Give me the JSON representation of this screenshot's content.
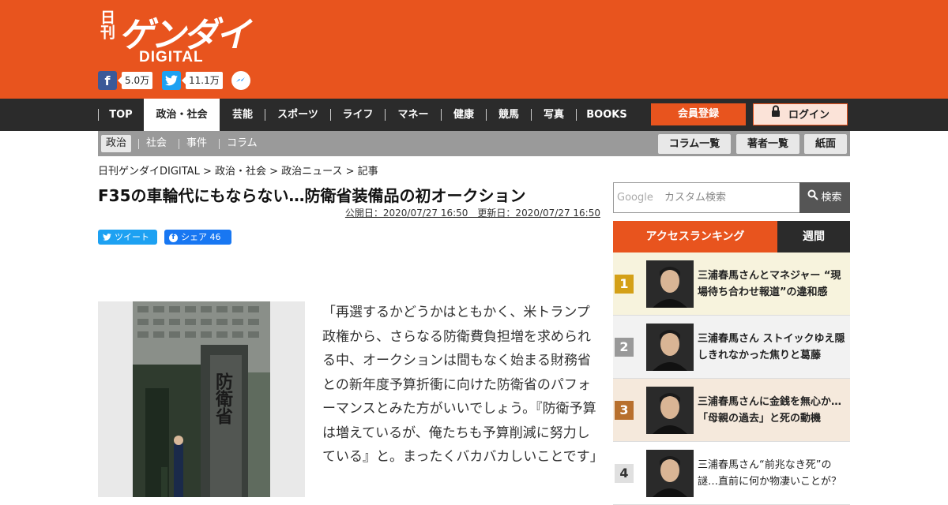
{
  "header": {
    "logo_small": "日刊",
    "logo_main": "ゲンダイ",
    "logo_sub": "DIGITAL",
    "facebook_count": "5.0万",
    "twitter_count": "11.1万"
  },
  "nav": {
    "items": [
      {
        "label": "TOP"
      },
      {
        "label": "政治・社会"
      },
      {
        "label": "芸能"
      },
      {
        "label": "スポーツ"
      },
      {
        "label": "ライフ"
      },
      {
        "label": "マネー"
      },
      {
        "label": "健康"
      },
      {
        "label": "競馬"
      },
      {
        "label": "写真"
      },
      {
        "label": "BOOKS"
      }
    ],
    "register_label": "会員登録",
    "login_label": "ログイン"
  },
  "subnav": {
    "items": [
      {
        "label": "政治"
      },
      {
        "label": "社会"
      },
      {
        "label": "事件"
      },
      {
        "label": "コラム"
      }
    ],
    "buttons": [
      {
        "label": "コラム一覧"
      },
      {
        "label": "著者一覧"
      },
      {
        "label": "紙面"
      }
    ]
  },
  "breadcrumb": "日刊ゲンダイDIGITAL > 政治・社会 > 政治ニュース > 記事",
  "article": {
    "title": "F35の車輪代にもならない…防衛省装備品の初オークション",
    "dates": "公開日：2020/07/27 16:50　更新日：2020/07/27 16:50",
    "tweet_label": "ツイート",
    "share_label": "シェア 46",
    "body": "「再選するかどうかはともかく、米トランプ政権から、さらなる防衛費負担増を求められる中、オークションは間もなく始まる財務省との新年度予算折衝に向けた防衛省のパフォーマンスとみた方がいいでしょう。『防衛予算は増えているが、俺たちも予算削減に努力している』と。まったくバカバカしいことです」",
    "photo_sign_text": "防衛省"
  },
  "search": {
    "placeholder_brand": "Google",
    "placeholder": "カスタム検索",
    "button_label": "検索"
  },
  "ranking": {
    "tab_access": "アクセスランキング",
    "tab_week": "週間",
    "items": [
      {
        "rank": "1",
        "title": "三浦春馬さんとマネジャー “現場待ち合わせ報道”の違和感",
        "bg": "#f7f3dd",
        "badge": "#d4a017"
      },
      {
        "rank": "2",
        "title": "三浦春馬さん ストイックゆえ隠しきれなかった焦りと葛藤",
        "bg": "#f2f2f2",
        "badge": "#999999"
      },
      {
        "rank": "3",
        "title": "三浦春馬さんに金銭を無心か…「母親の過去」と死の動機",
        "bg": "#f5e9dc",
        "badge": "#b8702e"
      },
      {
        "rank": "4",
        "title": "三浦春馬さん“前兆なき死”の謎…直前に何か物凄いことが？",
        "bg": "#ffffff",
        "badge": "#e0e0e0"
      }
    ]
  },
  "colors": {
    "brand": "#e8541e",
    "nav_bg": "#2b2b2b"
  }
}
